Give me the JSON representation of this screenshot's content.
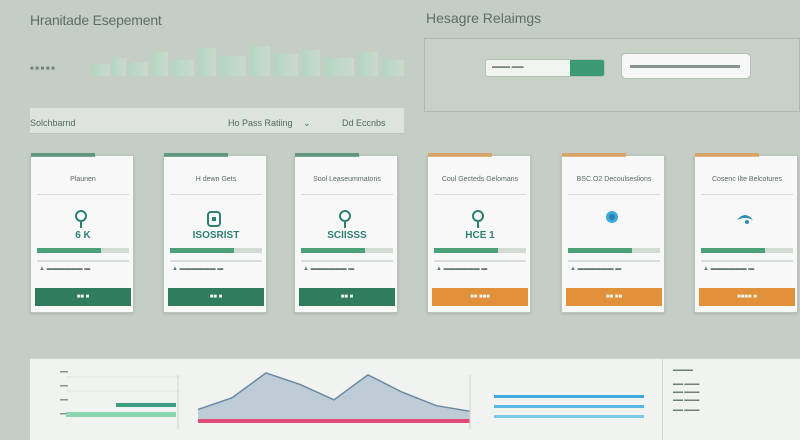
{
  "header": {
    "app_title": "Hranitade Esepement",
    "sub_info": "■ ■ ■ ■ ■"
  },
  "right_header": {
    "title": "Hesagre Relaimgs"
  },
  "filter_bar": {
    "left": "Solchbarnd",
    "mid": "Ho Pass Ratiing",
    "right": "Dd Eccnbs",
    "caret": "⌄"
  },
  "cards": [
    {
      "title": "Plaunen",
      "value": "6 K",
      "button": "■■ ■",
      "accent": "#2f7d5c",
      "icon": "pin-icon"
    },
    {
      "title": "H dewn Gets",
      "value": "ISOSRIST",
      "button": "■■ ■",
      "accent": "#2f7d5c",
      "icon": "box-icon"
    },
    {
      "title": "Sool Leaseummatons",
      "value": "SCIISSS",
      "button": "■■ ■",
      "accent": "#2f7d5c",
      "icon": "pin-icon"
    },
    {
      "title": "Coul Gecteds Gelomans",
      "value": "HCE 1",
      "button": "■■ ■■■",
      "accent": "#e0913a",
      "icon": "pin-icon"
    },
    {
      "title": "BSC.O2 Decoulseslions",
      "value": "",
      "button": "■■ ■■",
      "accent": "#e0913a",
      "icon": "cloud-icon"
    },
    {
      "title": "Cosenc Ilte Belcotures",
      "value": "",
      "button": "■■■■ ■",
      "accent": "#e0913a",
      "icon": "bird-icon"
    }
  ],
  "colors": {
    "green": "#2f7d5c",
    "orange": "#e0913a",
    "teal": "#2e7f73",
    "mint": "#8bd4b0"
  },
  "chart_data": {
    "type": "area",
    "title": "",
    "xlabel": "",
    "ylabel": "",
    "series": [
      {
        "x": [
          0,
          1,
          2,
          3,
          4,
          5,
          6,
          7,
          8
        ],
        "values": [
          10,
          22,
          48,
          36,
          20,
          46,
          28,
          14,
          8
        ]
      }
    ]
  }
}
